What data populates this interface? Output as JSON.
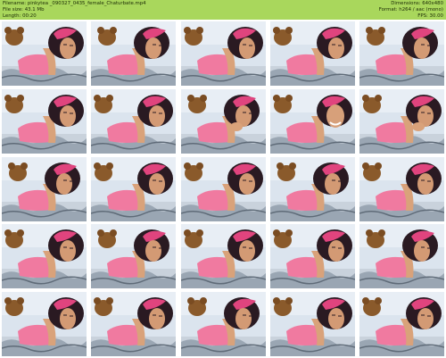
{
  "header": {
    "filename_line": "Filename: pinkytea _090327_0435_female_Chaturbate.mp4",
    "filesize_line": "File size: 43.1 Mb",
    "length_line": "Length: 00:20",
    "dimensions_line": "Dimensions: 640x480",
    "format_line": "Format: h264 / aac (mono)",
    "fps_line": "FPS: 30.00",
    "background_color": "#a9d75c"
  },
  "grid": {
    "rows": 5,
    "columns": 5,
    "thumbnails": [
      {
        "pose": "lying"
      },
      {
        "pose": "lying"
      },
      {
        "pose": "lying"
      },
      {
        "pose": "lying"
      },
      {
        "pose": "lying"
      },
      {
        "pose": "lying"
      },
      {
        "pose": "lying"
      },
      {
        "pose": "hand"
      },
      {
        "pose": "smile"
      },
      {
        "pose": "hand"
      },
      {
        "pose": "lying"
      },
      {
        "pose": "lying"
      },
      {
        "pose": "lying"
      },
      {
        "pose": "lying"
      },
      {
        "pose": "lying"
      },
      {
        "pose": "lying"
      },
      {
        "pose": "lying"
      },
      {
        "pose": "lying"
      },
      {
        "pose": "lying"
      },
      {
        "pose": "lying"
      },
      {
        "pose": "lying"
      },
      {
        "pose": "lying"
      },
      {
        "pose": "lying"
      },
      {
        "pose": "lying"
      },
      {
        "pose": "lying"
      }
    ]
  }
}
